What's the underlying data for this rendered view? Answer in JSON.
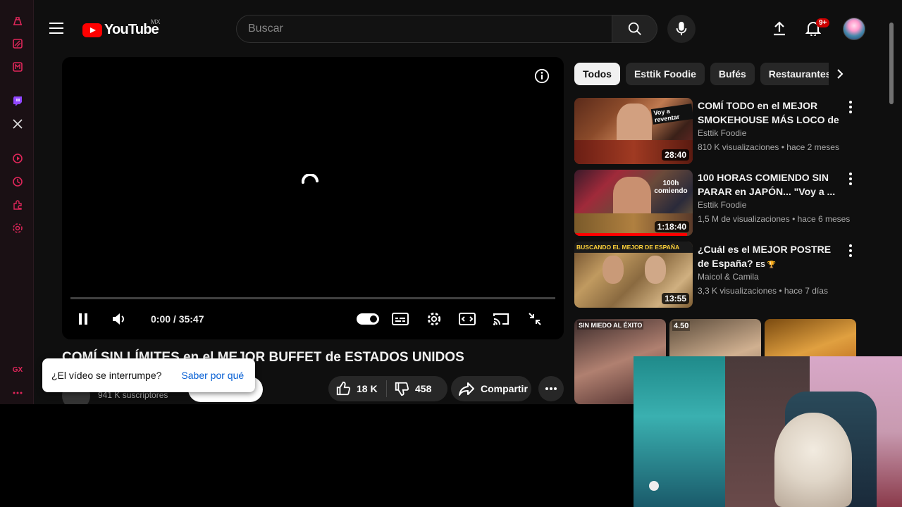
{
  "gx_sidebar": {
    "label": "GX",
    "icons": [
      "gx-controls-icon",
      "gx-corner-icon",
      "gx-mail-icon",
      "twitch-icon",
      "x-icon",
      "player-icon",
      "history-icon",
      "extensions-icon",
      "settings-icon",
      "more-icon"
    ]
  },
  "header": {
    "logo_text": "YouTube",
    "country_code": "MX",
    "search_placeholder": "Buscar",
    "notification_badge": "9+"
  },
  "player": {
    "time": "0:00 / 35:47",
    "progress": 0
  },
  "video": {
    "title": "COMÍ SIN LÍMITES en el MEJOR BUFFET de ESTADOS UNIDOS",
    "subscribers": "941 K suscriptores",
    "likes": "18 K",
    "dislikes": "458",
    "share_label": "Compartir"
  },
  "toast": {
    "question": "¿El vídeo se interrumpe?",
    "link": "Saber por qué"
  },
  "chips": [
    "Todos",
    "Esttik Foodie",
    "Bufés",
    "Restaurantes"
  ],
  "recommendations": [
    {
      "title": "COMÍ TODO en el MEJOR SMOKEHOUSE MÁS LOCO de ...",
      "channel": "Esttik Foodie",
      "meta": "810 K visualizaciones • hace 2 meses",
      "duration": "28:40",
      "thumb_text": "Voy a reventar"
    },
    {
      "title": "100 HORAS COMIENDO SIN PARAR en JAPÓN... \"Voy a ...",
      "channel": "Esttik Foodie",
      "meta": "1,5 M de visualizaciones • hace 6 meses",
      "duration": "1:18:40",
      "thumb_text": "100h comiendo"
    },
    {
      "title": "¿Cuál es el MEJOR POSTRE de España?",
      "title_suffix": "ES 🏆",
      "channel": "Maicol & Camila",
      "meta": "3,3 K visualizaciones • hace 7 días",
      "duration": "13:55",
      "thumb_text": "BUSCANDO EL MEJOR DE ESPAÑA"
    }
  ],
  "shorts": [
    {
      "caption": "SIN MIEDO AL ÉXITO"
    },
    {
      "caption": "4.50"
    },
    {
      "caption": ""
    }
  ],
  "colors": {
    "brand_red": "#ff0000",
    "gx_accent": "#e0265a",
    "link_blue": "#065fd4",
    "background": "#0f0f0f"
  }
}
